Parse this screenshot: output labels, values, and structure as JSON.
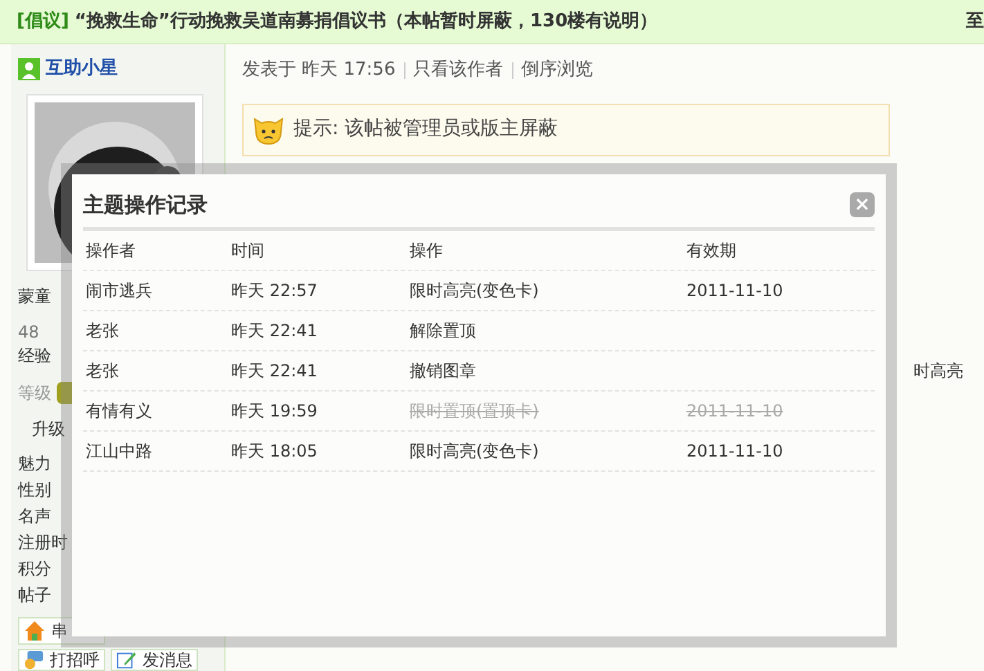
{
  "thread": {
    "tag": "[倡议]",
    "title": "“挽救生命”行动挽救吴道南募捐倡议书（本帖暂时屏蔽，130楼有说明）",
    "edge_text": "至"
  },
  "author": {
    "name": "互助小星",
    "rank": "蒙童",
    "stats": [
      {
        "value": "48",
        "label": "经验"
      }
    ],
    "level_label": "等级",
    "upgrade": "升级",
    "fields": [
      "魅力",
      "性别",
      "名声",
      "注册时",
      "积分",
      "帖子"
    ],
    "actions": [
      {
        "label": "串",
        "kind": "home"
      },
      {
        "label": "打招呼",
        "kind": "greet"
      },
      {
        "label": "发消息",
        "kind": "message"
      }
    ]
  },
  "post": {
    "meta": "发表于 昨天 17:56",
    "links": [
      "只看该作者",
      "倒序浏览"
    ],
    "notice": "提示: 该帖被管理员或版主屏蔽",
    "side_text": "时高亮"
  },
  "dialog": {
    "title": "主题操作记录",
    "close": "×",
    "columns": [
      "操作者",
      "时间",
      "操作",
      "有效期"
    ],
    "rows": [
      {
        "operator": "闹市逃兵",
        "time": "昨天 22:57",
        "action": "限时高亮(变色卡)",
        "expiry": "2011-11-10",
        "revoked": false
      },
      {
        "operator": "老张",
        "time": "昨天 22:41",
        "action": "解除置顶",
        "revoked": false
      },
      {
        "operator": "老张",
        "time": "昨天 22:41",
        "action": "撤销图章",
        "revoked": false
      },
      {
        "operator": "有情有义",
        "time": "昨天 19:59",
        "action": "限时置顶(置顶卡)",
        "expiry": "2011-11-10",
        "revoked": true
      },
      {
        "operator": "江山中路",
        "time": "昨天 18:05",
        "action": "限时高亮(变色卡)",
        "expiry": "2011-11-10",
        "revoked": false
      }
    ]
  }
}
